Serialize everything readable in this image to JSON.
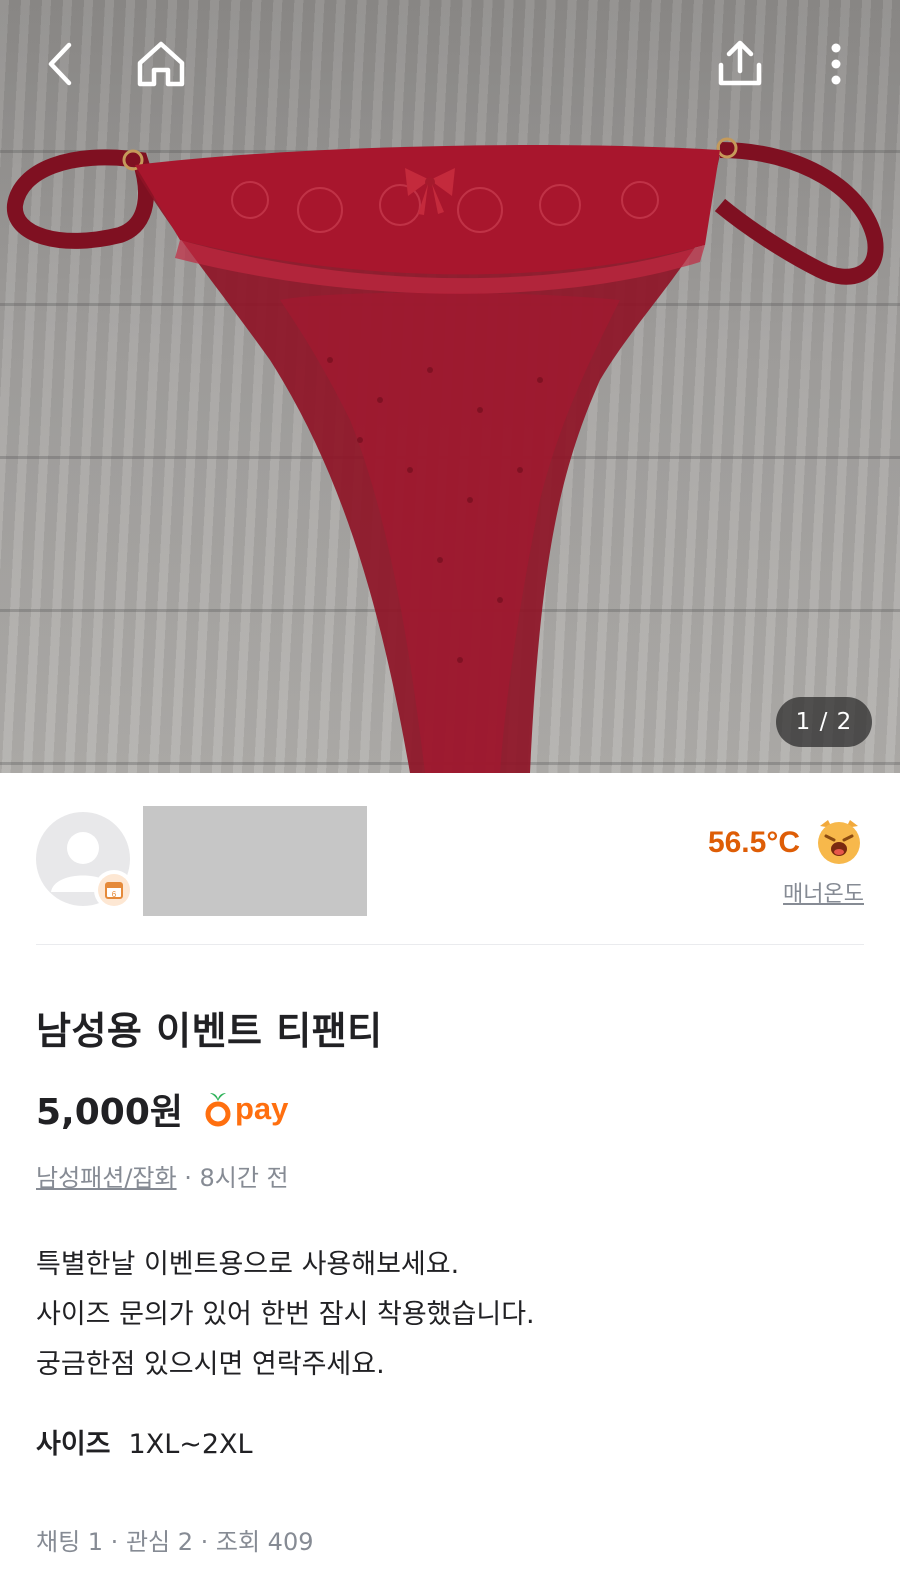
{
  "hero": {
    "image_description_icon": "product-photo",
    "counter": "1 / 2"
  },
  "icons": {
    "back": "chevron-left-icon",
    "home": "home-icon",
    "share": "share-icon",
    "more": "more-vertical-icon"
  },
  "seller": {
    "manner_temp": "56.5°C",
    "manner_label": "매너온도"
  },
  "product": {
    "title": "남성용 이벤트 티팬티",
    "price": "5,000원",
    "pay_label": "pay",
    "category": "남성패션/잡화",
    "time": " · 8시간 전",
    "description": [
      "특별한날 이벤트용으로 사용해보세요.",
      "사이즈 문의가 있어 한번 잠시 착용했습니다.",
      "궁금한점 있으시면 연락주세요."
    ],
    "size_label": "사이즈",
    "size_value": "1XL~2XL",
    "stats": "채팅 1 · 관심 2 · 조회 409"
  },
  "colors": {
    "accent": "#ff6f0f",
    "manner": "#de5d06",
    "muted": "#868b94",
    "text": "#212124"
  }
}
